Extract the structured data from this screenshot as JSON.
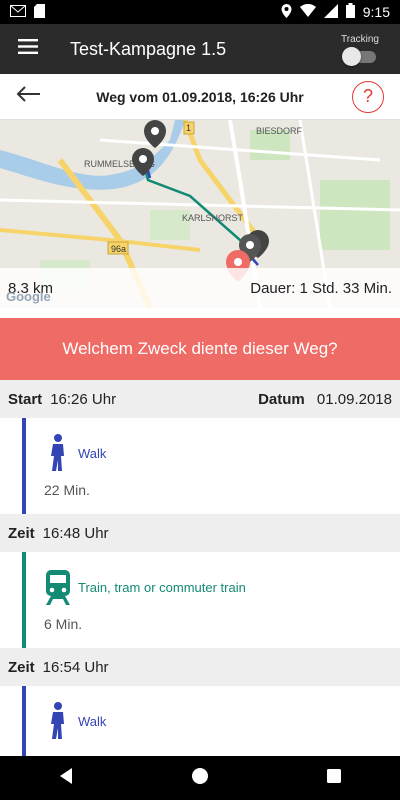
{
  "status_bar": {
    "time": "9:15",
    "icons": [
      "gmail-icon",
      "sd-card-icon",
      "location-icon",
      "wifi-icon",
      "signal-icon",
      "battery-icon"
    ]
  },
  "app_bar": {
    "title": "Test-Kampagne 1.5",
    "tracking_label": "Tracking",
    "tracking_on": false
  },
  "trip_header": {
    "title": "Weg vom 01.09.2018, 16:26 Uhr",
    "help_label": "?"
  },
  "map": {
    "labels": [
      "RUMMELSBURG",
      "BIESDORF",
      "KARLSHORST",
      "96a",
      "1"
    ],
    "google_label": "Google",
    "distance": "8.3 km",
    "duration": "Dauer: 1 Std. 33 Min."
  },
  "purpose_prompt": "Welchem Zweck diente dieser Weg?",
  "start": {
    "label": "Start",
    "time": "16:26 Uhr",
    "date_label": "Datum",
    "date": "01.09.2018"
  },
  "segments": [
    {
      "mode": "Walk",
      "icon": "walk-icon",
      "duration": "22 Min.",
      "color": "#3344b5"
    },
    {
      "mode": "Train, tram or commuter train",
      "icon": "train-icon",
      "duration": "6 Min.",
      "color": "#128a74"
    },
    {
      "mode": "Walk",
      "icon": "walk-icon",
      "duration": "",
      "color": "#3344b5"
    }
  ],
  "stops": [
    {
      "label": "Zeit",
      "time": "16:48 Uhr"
    },
    {
      "label": "Zeit",
      "time": "16:54 Uhr"
    }
  ],
  "colors": {
    "purpose_bar": "#ef6b65",
    "walk": "#3344b5",
    "train": "#128a74",
    "help": "#e53935",
    "app_bar": "#2b2b2b"
  }
}
